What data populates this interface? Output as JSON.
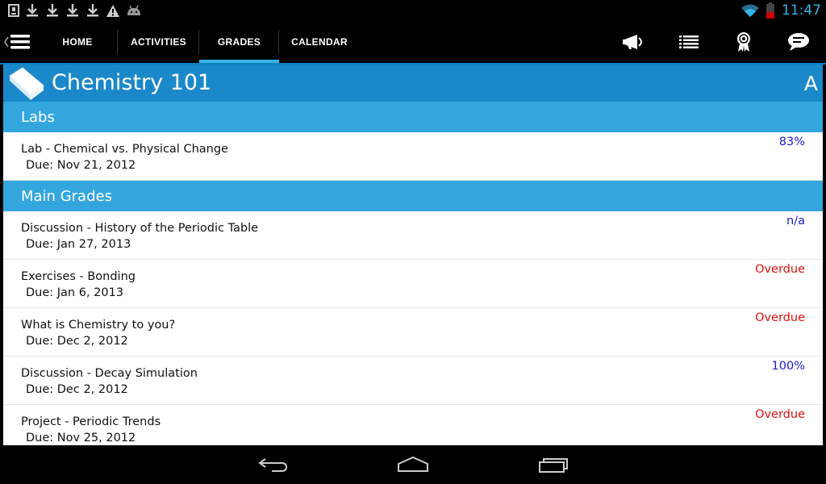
{
  "status_bar": {
    "time": "11:47",
    "notification_icons": [
      "sd-card-icon",
      "download-icon",
      "download-icon",
      "download-icon",
      "download-icon",
      "warning-icon",
      "android-icon"
    ],
    "system_icons": [
      "wifi-icon",
      "battery-icon"
    ]
  },
  "action_bar": {
    "tabs": [
      {
        "label": "HOME",
        "active": false
      },
      {
        "label": "ACTIVITIES",
        "active": false
      },
      {
        "label": "GRADES",
        "active": true
      },
      {
        "label": "CALENDAR",
        "active": false
      }
    ],
    "icons": [
      "megaphone-icon",
      "list-icon",
      "award-icon",
      "chat-icon"
    ]
  },
  "course": {
    "title": "Chemistry 101",
    "grade": "A"
  },
  "sections": [
    {
      "title": "Labs",
      "items": [
        {
          "title": "Lab - Chemical vs. Physical Change",
          "due": "Due: Nov 21, 2012",
          "status": "83%",
          "status_color": "#1a1ad6"
        }
      ]
    },
    {
      "title": "Main Grades",
      "items": [
        {
          "title": "Discussion - History of the Periodic Table",
          "due": "Due: Jan 27, 2013",
          "status": "n/a",
          "status_color": "#1a1ad6"
        },
        {
          "title": "Exercises - Bonding",
          "due": "Due: Jan 6, 2013",
          "status": "Overdue",
          "status_color": "#e01010"
        },
        {
          "title": "What is Chemistry to you?",
          "due": "Due: Dec 2, 2012",
          "status": "Overdue",
          "status_color": "#e01010"
        },
        {
          "title": "Discussion - Decay Simulation",
          "due": "Due: Dec 2, 2012",
          "status": "100%",
          "status_color": "#1a1ad6"
        },
        {
          "title": "Project - Periodic Trends",
          "due": "Due: Nov 25, 2012",
          "status": "Overdue",
          "status_color": "#e01010"
        }
      ]
    }
  ],
  "nav_bar": {
    "buttons": [
      "back-icon",
      "home-icon",
      "recent-apps-icon"
    ]
  },
  "colors": {
    "header_blue": "#1b88c9",
    "section_blue": "#33a6de",
    "accent": "#33b5e5"
  }
}
